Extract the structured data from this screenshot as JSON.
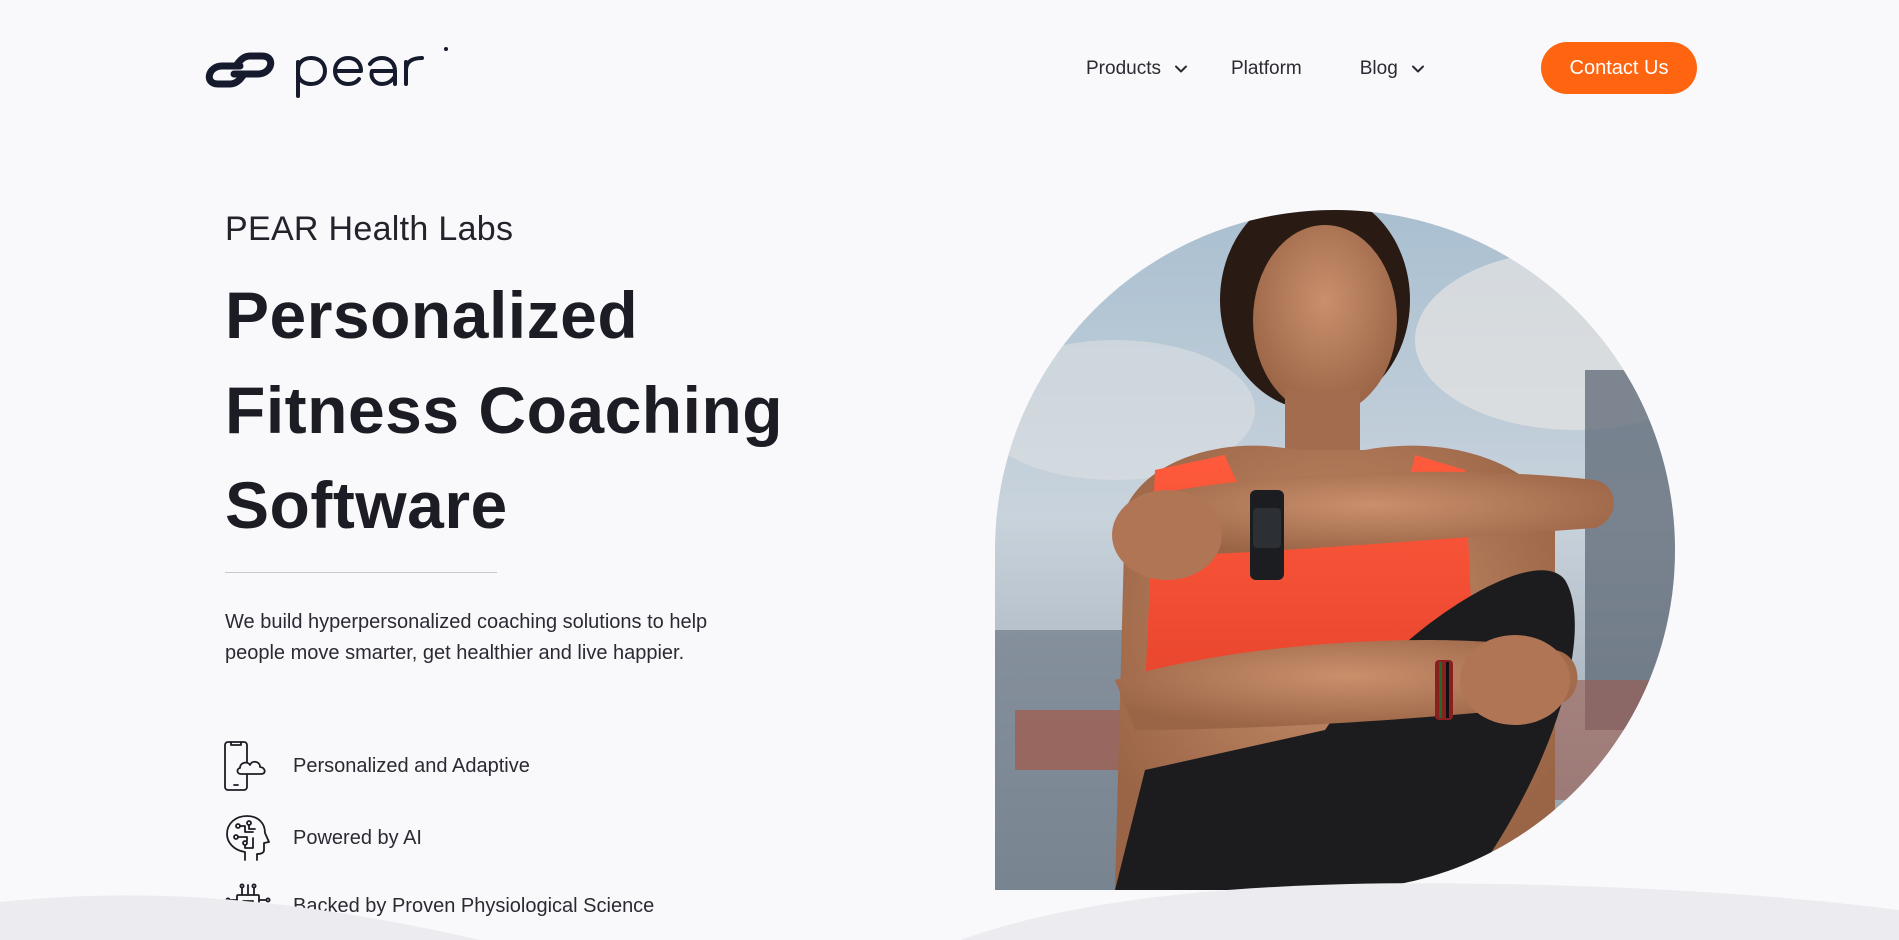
{
  "header": {
    "logo_text": "pear",
    "nav": [
      {
        "label": "Products",
        "has_dropdown": true
      },
      {
        "label": "Platform",
        "has_dropdown": false
      },
      {
        "label": "Blog",
        "has_dropdown": true
      }
    ],
    "cta_label": "Contact Us"
  },
  "hero": {
    "eyebrow": "PEAR Health Labs",
    "headline_lines": [
      "Personalized",
      "Fitness Coaching",
      "Software"
    ],
    "description": "We build hyperpersonalized coaching solutions to help people move smarter, get healthier and live happier.",
    "features": [
      {
        "icon": "phone-cloud-icon",
        "label": "Personalized and Adaptive"
      },
      {
        "icon": "ai-head-icon",
        "label": "Powered by AI"
      },
      {
        "icon": "chip-icon",
        "label": "Backed by Proven Physiological Science"
      }
    ],
    "image": "woman-checking-smartwatch-photo"
  },
  "colors": {
    "background": "#f9f9fb",
    "accent": "#ff6510",
    "text": "#1c1c24",
    "logo": "#151b2c"
  }
}
